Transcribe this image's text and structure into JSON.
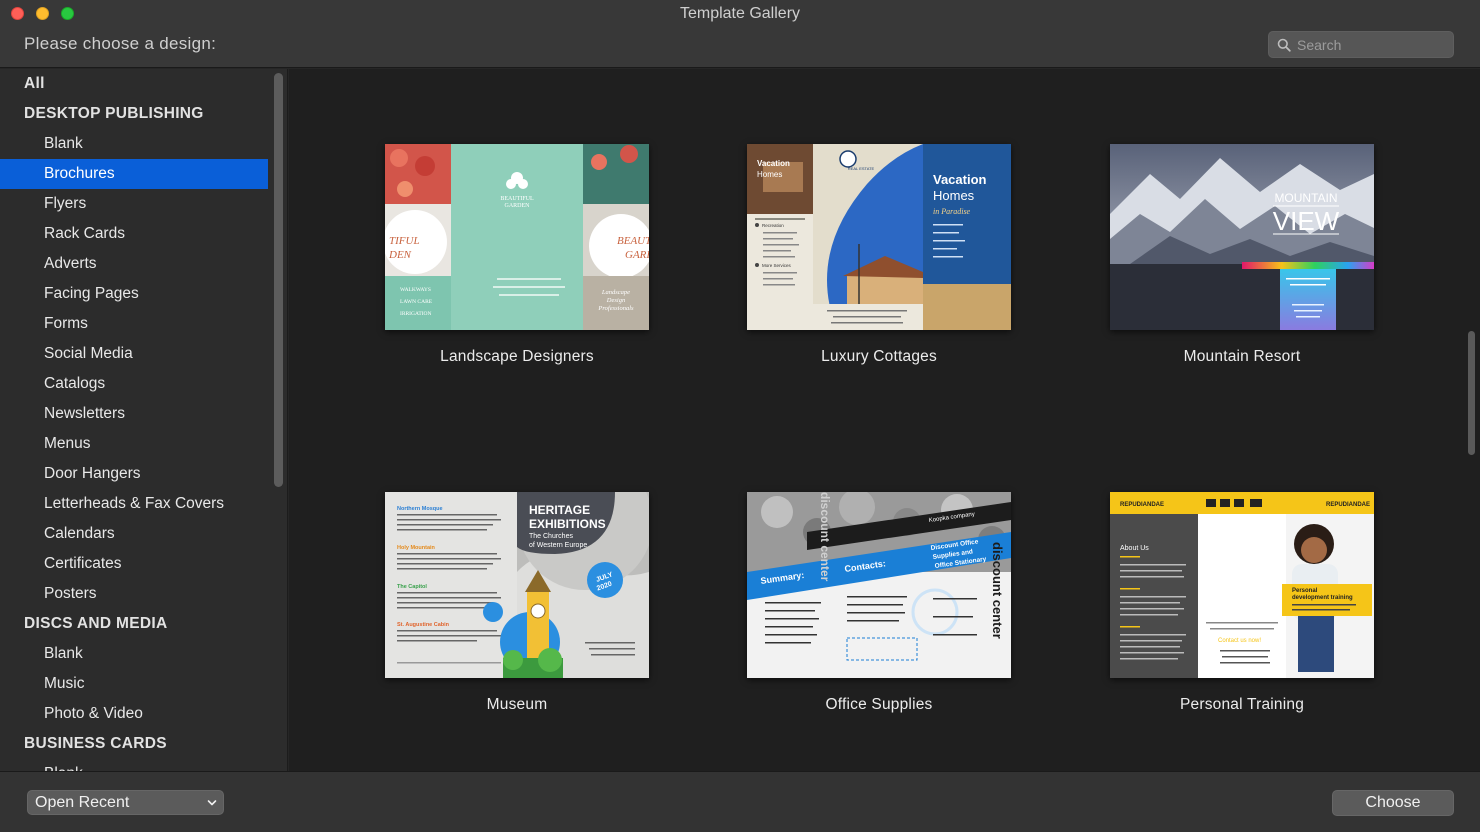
{
  "window": {
    "title": "Template Gallery",
    "prompt": "Please choose a design:"
  },
  "search": {
    "placeholder": "Search",
    "value": ""
  },
  "sidebar": {
    "items": [
      {
        "label": "All",
        "type": "header"
      },
      {
        "label": "DESKTOP PUBLISHING",
        "type": "header"
      },
      {
        "label": "Blank",
        "type": "item"
      },
      {
        "label": "Brochures",
        "type": "item",
        "selected": true
      },
      {
        "label": "Flyers",
        "type": "item"
      },
      {
        "label": "Rack Cards",
        "type": "item"
      },
      {
        "label": "Adverts",
        "type": "item"
      },
      {
        "label": "Facing Pages",
        "type": "item"
      },
      {
        "label": "Forms",
        "type": "item"
      },
      {
        "label": "Social Media",
        "type": "item"
      },
      {
        "label": "Catalogs",
        "type": "item"
      },
      {
        "label": "Newsletters",
        "type": "item"
      },
      {
        "label": "Menus",
        "type": "item"
      },
      {
        "label": "Door Hangers",
        "type": "item"
      },
      {
        "label": "Letterheads & Fax Covers",
        "type": "item"
      },
      {
        "label": "Calendars",
        "type": "item"
      },
      {
        "label": "Certificates",
        "type": "item"
      },
      {
        "label": "Posters",
        "type": "item"
      },
      {
        "label": "DISCS AND MEDIA",
        "type": "header"
      },
      {
        "label": "Blank",
        "type": "item"
      },
      {
        "label": "Music",
        "type": "item"
      },
      {
        "label": "Photo & Video",
        "type": "item"
      },
      {
        "label": "BUSINESS CARDS",
        "type": "header"
      },
      {
        "label": "Blank",
        "type": "item"
      }
    ]
  },
  "templates": [
    {
      "name": "Landscape Designers",
      "thumb_text": [
        "BEAUTIFUL",
        "GARDEN",
        "TIFUL",
        "DEN",
        "BEAUT",
        "GARI",
        "WALKWAYS",
        "LAWN CARE",
        "IRRIGATION",
        "Landscape",
        "Design",
        "Professionals"
      ]
    },
    {
      "name": "Luxury Cottages",
      "thumb_text": [
        "Vacation",
        "Homes",
        "in Paradise",
        "REAL ESTATE",
        "Recreation",
        "More Services"
      ]
    },
    {
      "name": "Mountain Resort",
      "thumb_text": [
        "MOUNTAIN",
        "VIEW"
      ]
    },
    {
      "name": "Museum",
      "thumb_text": [
        "HERITAGE",
        "EXHIBITIONS",
        "The Churches",
        "of Western Europe",
        "JULY",
        "2020",
        "Northern Mosque",
        "Holy Mountain",
        "The Capitol",
        "St. Augustine Cabin"
      ]
    },
    {
      "name": "Office Supplies",
      "thumb_text": [
        "Summary:",
        "Contacts:",
        "discount center",
        "Discount Office",
        "Supplies and",
        "Office Stationary",
        "Koopka company"
      ]
    },
    {
      "name": "Personal Training",
      "thumb_text": [
        "REPUDIANDAE",
        "About Us",
        "Personal",
        "development training",
        "Contact us now!"
      ]
    }
  ],
  "colors": {
    "accent": "#0a5fd8",
    "sidebar_bg": "#2c2c2c",
    "gallery_bg": "#1f1f1f"
  },
  "bottom": {
    "open_recent_label": "Open Recent",
    "choose_label": "Choose"
  }
}
